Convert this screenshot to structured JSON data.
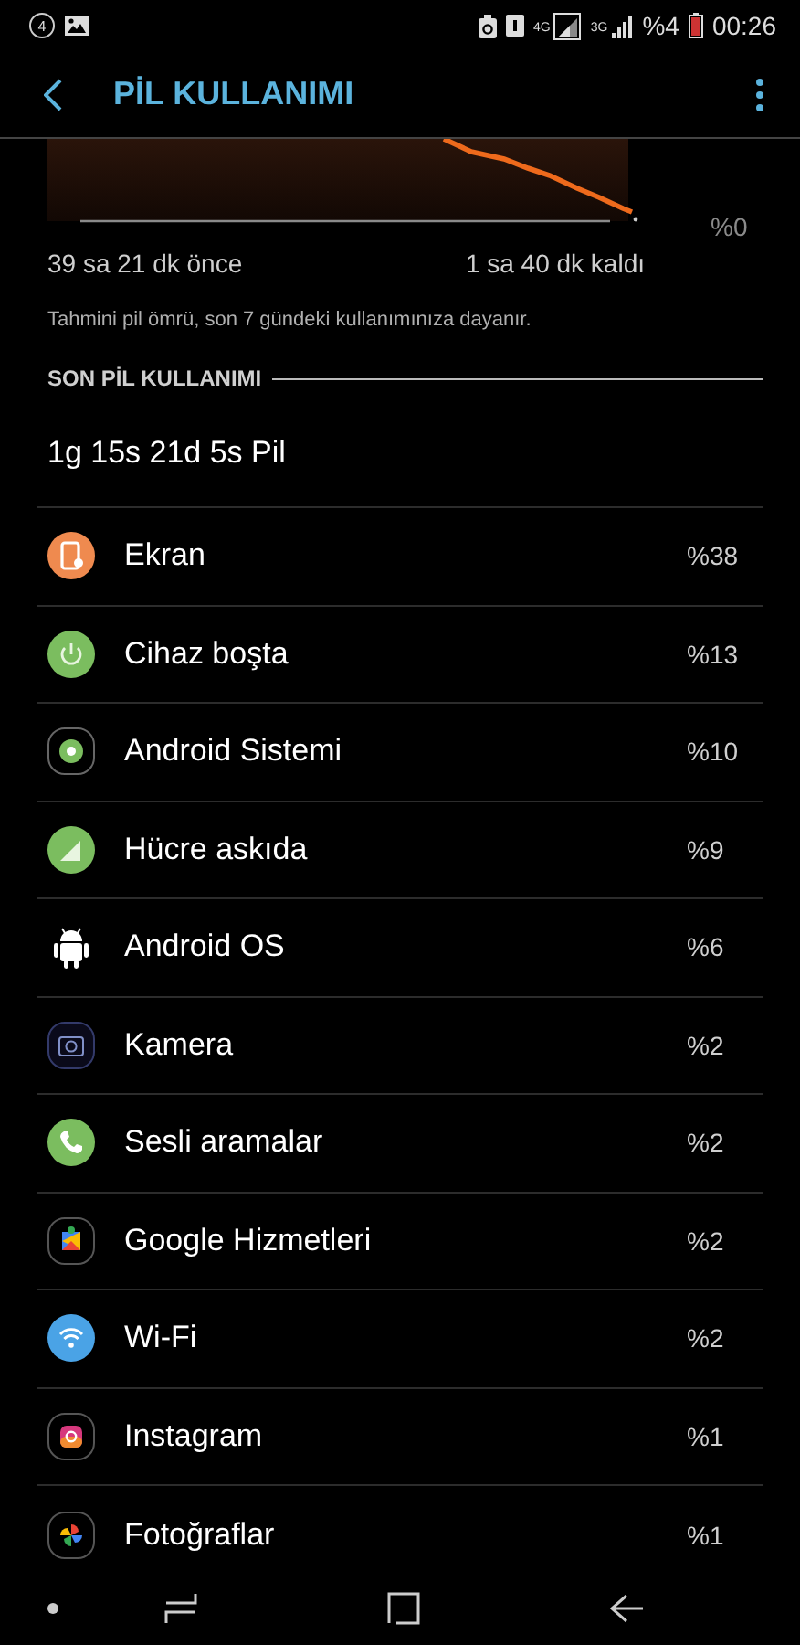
{
  "status_bar": {
    "notification_count": "4",
    "network_1": "4G",
    "network_2": "3G",
    "battery": "%4",
    "time": "00:26"
  },
  "app_bar": {
    "title": "PİL KULLANIMI"
  },
  "graph": {
    "y_label": "%0",
    "start_label": "39 sa 21 dk önce",
    "end_label": "1 sa 40 dk kaldı",
    "note": "Tahmini pil ömrü, son 7 gündeki kullanımınıza dayanır."
  },
  "section": {
    "title": "SON PİL KULLANIMI",
    "summary": "1g 15s 21d 5s Pil"
  },
  "items": [
    {
      "name": "Ekran",
      "percent": "%38",
      "kind": "screen"
    },
    {
      "name": "Cihaz boşta",
      "percent": "%13",
      "kind": "power"
    },
    {
      "name": "Android Sistemi",
      "percent": "%10",
      "kind": "system"
    },
    {
      "name": "Hücre askıda",
      "percent": "%9",
      "kind": "signal"
    },
    {
      "name": "Android OS",
      "percent": "%6",
      "kind": "robot"
    },
    {
      "name": "Kamera",
      "percent": "%2",
      "kind": "camera"
    },
    {
      "name": "Sesli aramalar",
      "percent": "%2",
      "kind": "phone"
    },
    {
      "name": "Google Hizmetleri",
      "percent": "%2",
      "kind": "puzzle"
    },
    {
      "name": "Wi-Fi",
      "percent": "%2",
      "kind": "wifi"
    },
    {
      "name": "Instagram",
      "percent": "%1",
      "kind": "instagram"
    },
    {
      "name": "Fotoğraflar",
      "percent": "%1",
      "kind": "pinwheel"
    }
  ]
}
